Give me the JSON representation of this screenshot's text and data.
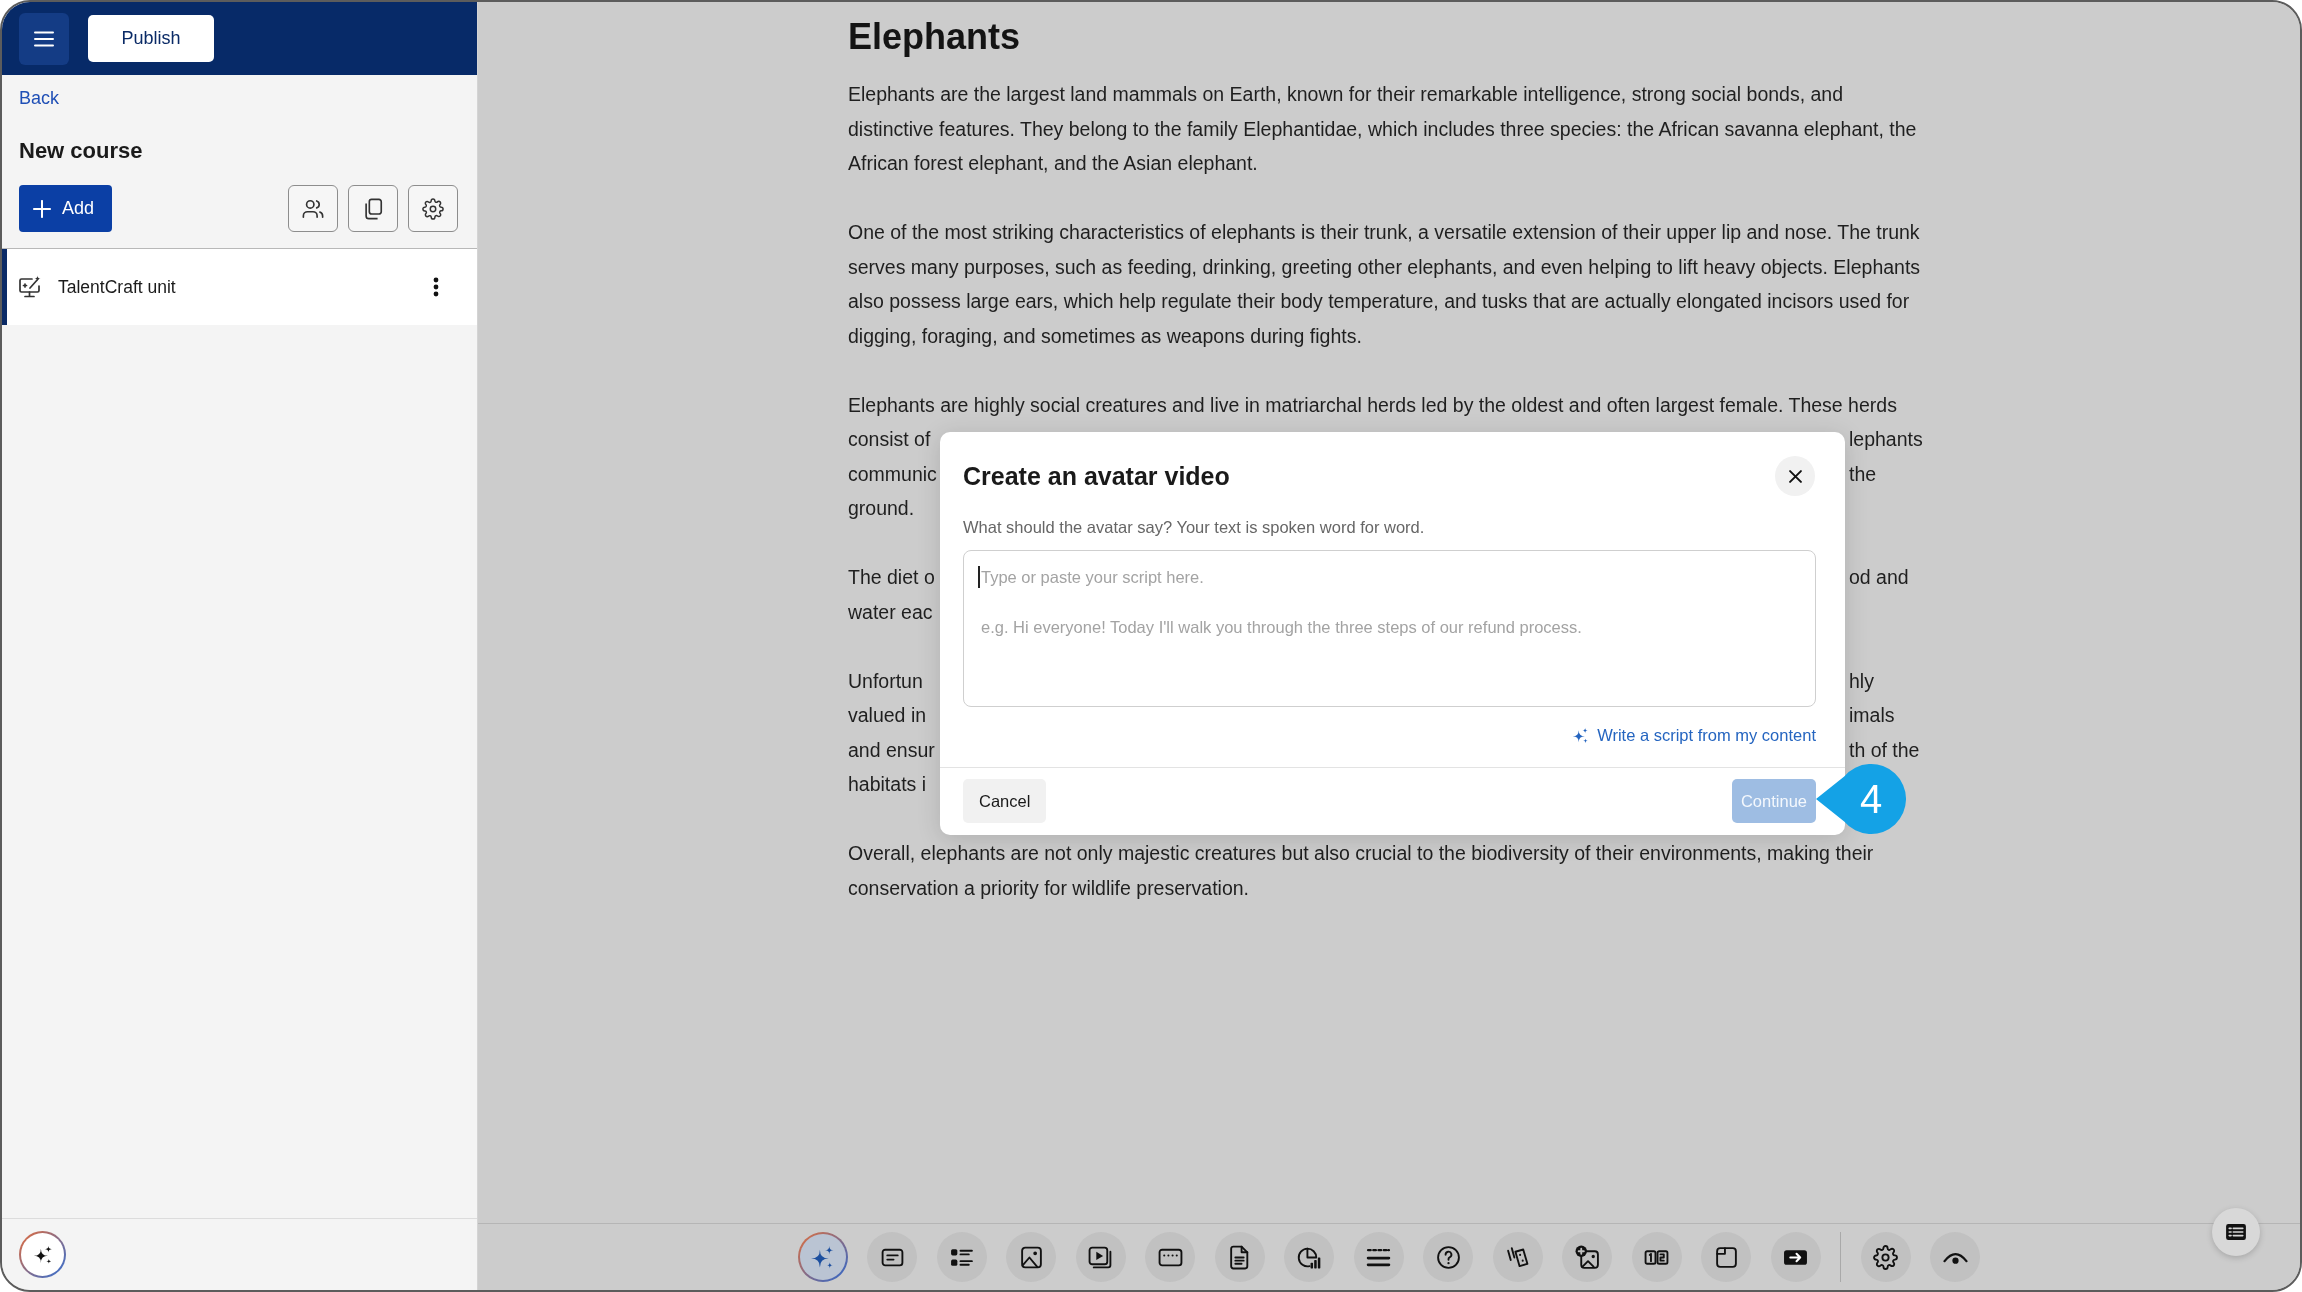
{
  "sidebar": {
    "publish_button": "Publish",
    "back_link": "Back",
    "course_title": "New course",
    "add_button": "Add",
    "units": [
      {
        "title": "TalentCraft unit",
        "selected": true
      }
    ]
  },
  "article": {
    "title": "Elephants",
    "paragraphs": [
      {
        "kind": "full",
        "text": "Elephants are the largest land mammals on Earth, known for their remarkable intelligence, strong social bonds, and distinctive features. They belong to the family Elephantidae, which includes three species: the African savanna elephant, the African forest elephant, and the Asian elephant."
      },
      {
        "kind": "full",
        "text": "One of the most striking characteristics of elephants is their trunk, a versatile extension of their upper lip and nose. The trunk serves many purposes, such as feeding, drinking, greeting other elephants, and even helping to lift heavy objects. Elephants also possess large ears, which help regulate their body temperature, and tusks that are actually elongated incisors used for digging, foraging, and sometimes as weapons during fights."
      },
      {
        "kind": "covered",
        "lines": [
          {
            "left": "Elephants are highly social creatures and live in matriarchal herds led by the oldest and often largest female. These herds"
          },
          {
            "left": "consist of",
            "right": "lephants"
          },
          {
            "left": "communic",
            "right": "the"
          },
          {
            "left": "ground."
          }
        ]
      },
      {
        "kind": "covered",
        "lines": [
          {
            "left": "The diet o",
            "right": "od and"
          },
          {
            "left": "water eac"
          }
        ]
      },
      {
        "kind": "covered",
        "lines": [
          {
            "left": "Unfortun",
            "right": "hly"
          },
          {
            "left": "valued in",
            "right": "imals"
          },
          {
            "left": "and ensur",
            "right": "th of the"
          },
          {
            "left": "habitats i"
          }
        ]
      },
      {
        "kind": "full",
        "text": "Overall, elephants are not only majestic creatures but also crucial to the biodiversity of their environments, making their conservation a priority for wildlife preservation."
      }
    ]
  },
  "dialog": {
    "title": "Create an avatar video",
    "prompt": "What should the avatar say? Your text is spoken word for word.",
    "script_field": {
      "placeholder": "Type or paste your script here.\n\ne.g. Hi everyone! Today I'll walk you through the three steps of our refund process.",
      "focused": true
    },
    "ai_link": "Write a script from my content",
    "cancel_button": "Cancel",
    "continue_button": {
      "label": "Continue",
      "disabled": true
    }
  },
  "step_badge": "4"
}
